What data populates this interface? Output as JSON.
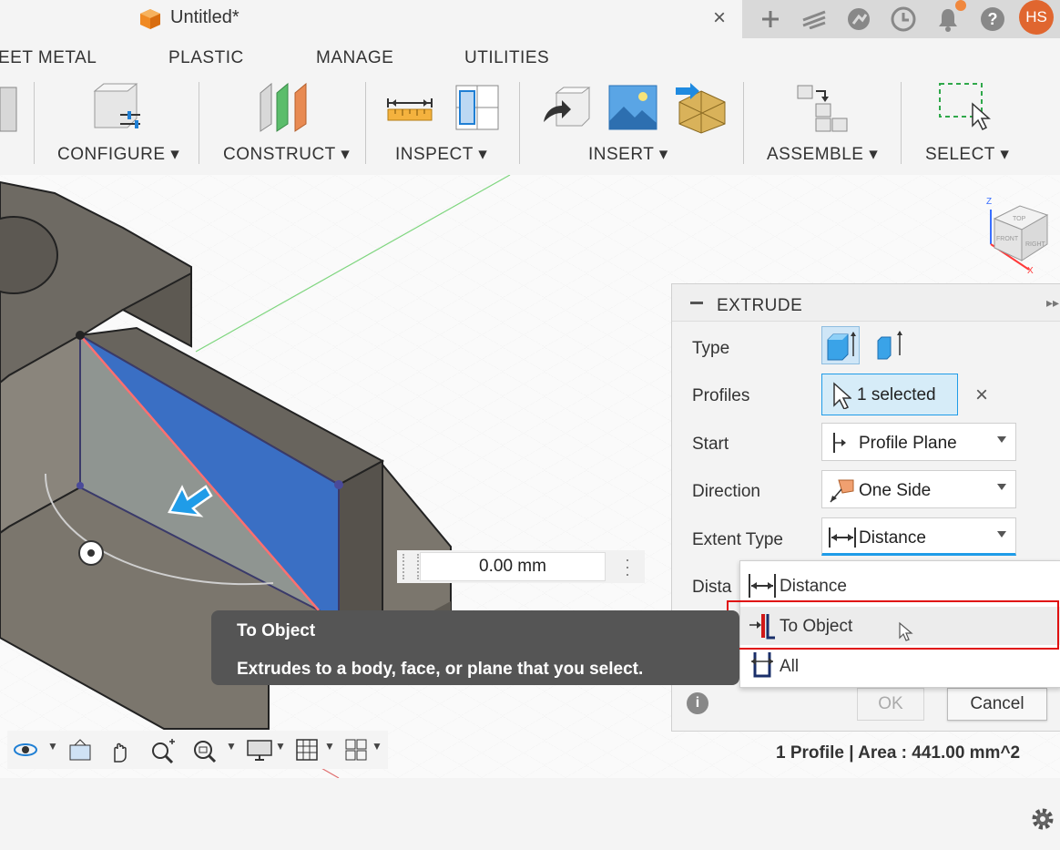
{
  "titlebar": {
    "title": "Untitled*",
    "close": "×",
    "avatar_initials": "HS",
    "accent": "#e0662f"
  },
  "tabs": [
    "EET METAL",
    "PLASTIC",
    "MANAGE",
    "UTILITIES"
  ],
  "ribbon": {
    "groups": [
      "CONFIGURE ▾",
      "CONSTRUCT ▾",
      "INSPECT ▾",
      "INSERT ▾",
      "ASSEMBLE ▾",
      "SELECT ▾"
    ]
  },
  "viewport": {
    "dimension_value": "0.00 mm",
    "viewcube": {
      "top": "TOP",
      "front": "FRONT",
      "right": "RIGHT",
      "z": "Z",
      "x": "X"
    }
  },
  "extrude": {
    "title": "EXTRUDE",
    "labels": {
      "type": "Type",
      "profiles": "Profiles",
      "start": "Start",
      "direction": "Direction",
      "extent_type": "Extent Type",
      "distance": "Dista"
    },
    "profiles_value": "1 selected",
    "clear": "×",
    "start_value": "Profile Plane",
    "direction_value": "One Side",
    "extent_value": "Distance",
    "ok": "OK",
    "cancel": "Cancel"
  },
  "dropdown": {
    "options": [
      "Distance",
      "To Object",
      "All"
    ],
    "highlighted": "To Object",
    "highlight_color": "#e01010"
  },
  "tooltip": {
    "title": "To Object",
    "body": "Extrudes to a body, face, or plane that you select."
  },
  "status": "1 Profile | Area : 441.00 mm^2",
  "colors": {
    "face_blue": "#3a6fc4",
    "model_gray": "#6e6a63",
    "panel_bg": "#f3f3f3",
    "select_blue": "#0696d7"
  }
}
